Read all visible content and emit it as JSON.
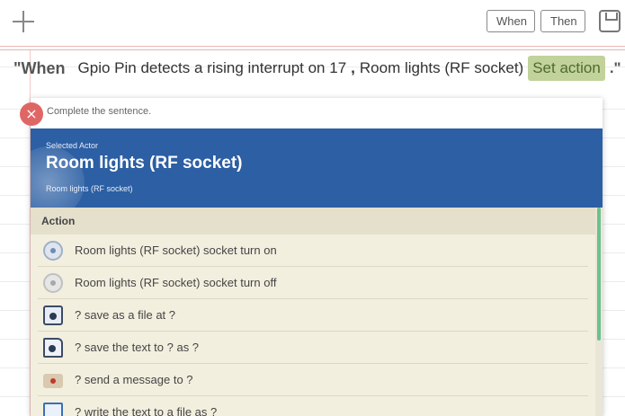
{
  "toolbar": {
    "when_label": "When",
    "then_label": "Then",
    "add_icon": "plus-icon",
    "save_icon": "save-icon"
  },
  "sentence": {
    "when_word": "\"When",
    "trigger_text": "Gpio Pin detects a rising interrupt on 17",
    "comma": ",",
    "actor_text": "Room lights (RF socket)",
    "set_action_label": "Set action",
    "end": ".\""
  },
  "popup": {
    "close_icon": "close-icon",
    "close_glyph": "×",
    "hint": "Complete the sentence.",
    "actor": {
      "kicker": "Selected Actor",
      "name": "Room lights (RF socket)",
      "sub": "Room lights (RF socket)"
    },
    "action_header": "Action",
    "actions": [
      {
        "icon": "socket-on-icon",
        "label": "Room lights (RF socket) socket turn on"
      },
      {
        "icon": "socket-off-icon",
        "label": "Room lights (RF socket) socket turn off"
      },
      {
        "icon": "camera-file-icon",
        "label": "? save as a file at ?"
      },
      {
        "icon": "text-file-icon",
        "label": "? save the text to ? as ?"
      },
      {
        "icon": "message-icon",
        "label": "? send a message to ?"
      },
      {
        "icon": "write-file-icon",
        "label": "? write the text to a file as ?"
      }
    ]
  },
  "colors": {
    "actor_header_bg": "#2c5fa3",
    "set_action_bg": "#c1d29a",
    "action_bg": "#f3efdf",
    "close_bg": "#e06666",
    "scroll_thumb": "#6cc08c"
  }
}
